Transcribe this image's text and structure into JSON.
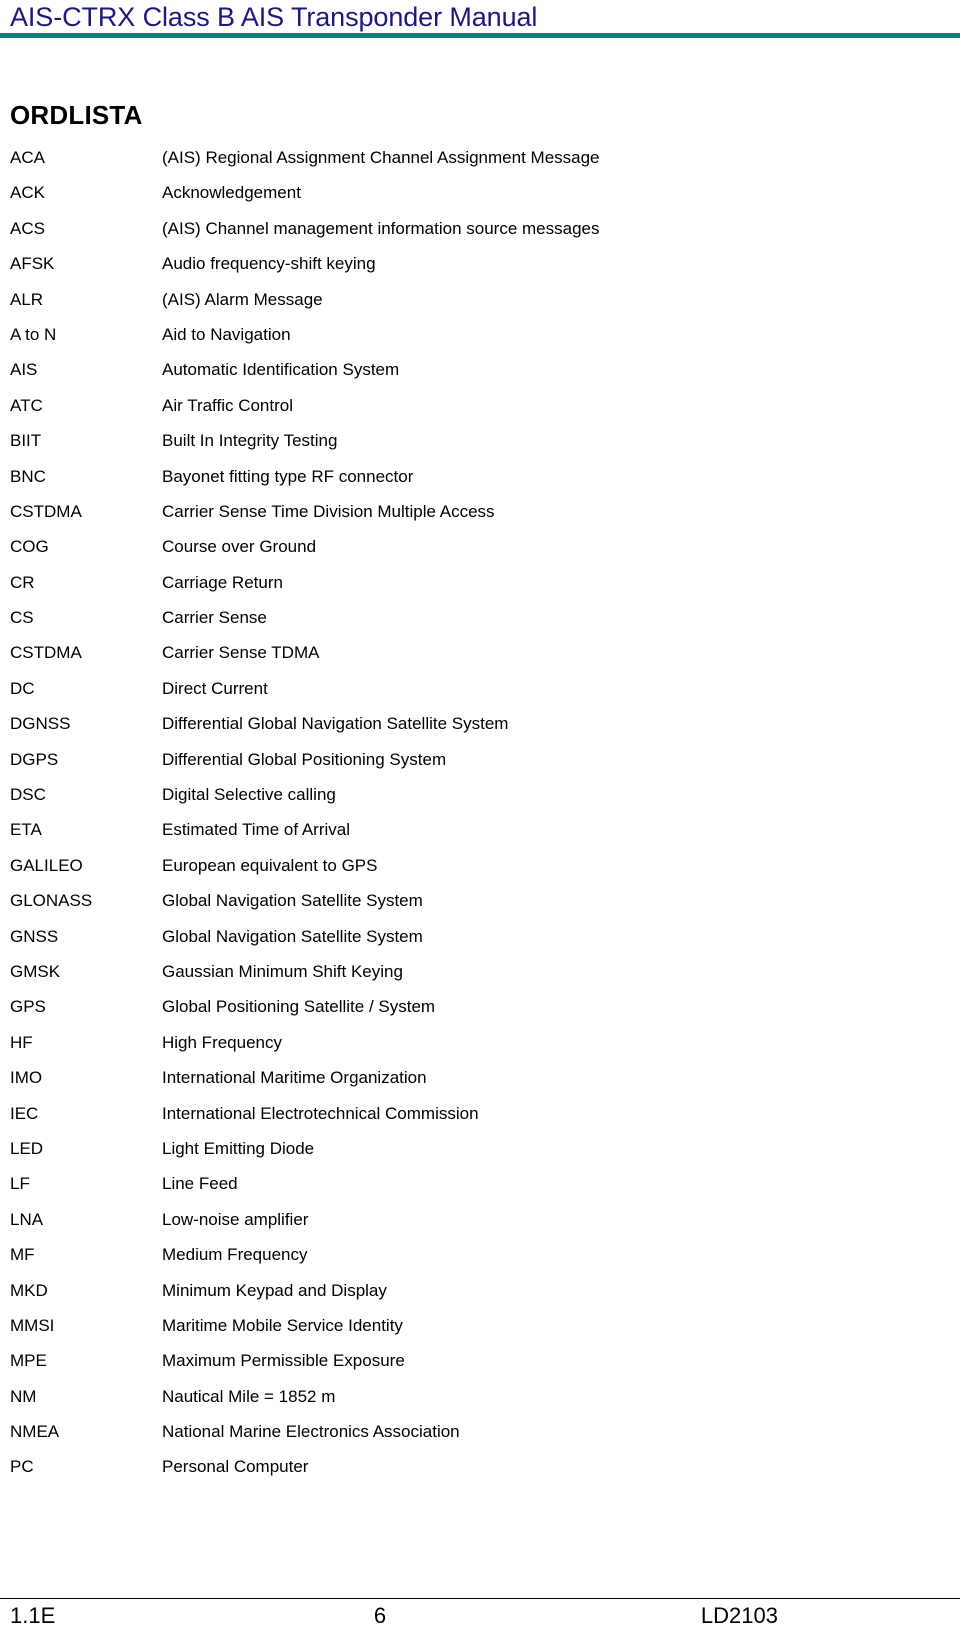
{
  "colors": {
    "header_title": "#1a1a7a",
    "header_rule": "#0e7d7d",
    "text": "#000000",
    "background": "#ffffff"
  },
  "header": {
    "title": "AIS-CTRX Class B AIS Transponder Manual"
  },
  "section": {
    "heading": "ORDLISTA"
  },
  "glossary": {
    "entries": [
      {
        "term": "ACA",
        "definition": "(AIS) Regional Assignment Channel Assignment Message"
      },
      {
        "term": "ACK",
        "definition": "Acknowledgement"
      },
      {
        "term": "ACS",
        "definition": "(AIS) Channel management information source messages"
      },
      {
        "term": "AFSK",
        "definition": "Audio frequency-shift keying"
      },
      {
        "term": "ALR",
        "definition": "(AIS) Alarm Message"
      },
      {
        "term": "A to N",
        "definition": "Aid to Navigation"
      },
      {
        "term": "AIS",
        "definition": "Automatic Identification System"
      },
      {
        "term": "ATC",
        "definition": "Air Traffic Control"
      },
      {
        "term": "BIIT",
        "definition": "Built In Integrity Testing"
      },
      {
        "term": "BNC",
        "definition": "Bayonet fitting type RF connector"
      },
      {
        "term": "CSTDMA",
        "definition": "Carrier Sense Time Division Multiple Access"
      },
      {
        "term": "COG",
        "definition": "Course over Ground"
      },
      {
        "term": "CR",
        "definition": "Carriage Return"
      },
      {
        "term": "CS",
        "definition": "Carrier Sense"
      },
      {
        "term": "CSTDMA",
        "definition": "Carrier Sense TDMA"
      },
      {
        "term": "DC",
        "definition": "Direct Current"
      },
      {
        "term": "DGNSS",
        "definition": "Differential Global Navigation Satellite System"
      },
      {
        "term": "DGPS",
        "definition": "Differential Global Positioning System"
      },
      {
        "term": "DSC",
        "definition": "Digital Selective calling"
      },
      {
        "term": "ETA",
        "definition": "Estimated Time of Arrival"
      },
      {
        "term": "GALILEO",
        "definition": "European equivalent to GPS"
      },
      {
        "term": "GLONASS",
        "definition": "Global Navigation Satellite System"
      },
      {
        "term": "GNSS",
        "definition": "Global Navigation Satellite System"
      },
      {
        "term": "GMSK",
        "definition": "Gaussian Minimum Shift Keying"
      },
      {
        "term": "GPS",
        "definition": "Global Positioning Satellite / System"
      },
      {
        "term": "HF",
        "definition": "High Frequency"
      },
      {
        "term": "IMO",
        "definition": "International Maritime Organization"
      },
      {
        "term": "IEC",
        "definition": "International Electrotechnical Commission"
      },
      {
        "term": "LED",
        "definition": "Light Emitting Diode"
      },
      {
        "term": "LF",
        "definition": "Line Feed"
      },
      {
        "term": "LNA",
        "definition": "Low-noise amplifier"
      },
      {
        "term": "MF",
        "definition": "Medium Frequency"
      },
      {
        "term": "MKD",
        "definition": "Minimum Keypad and Display"
      },
      {
        "term": "MMSI",
        "definition": "Maritime Mobile Service Identity"
      },
      {
        "term": "MPE",
        "definition": "Maximum Permissible Exposure"
      },
      {
        "term": "NM",
        "definition": "Nautical Mile = 1852 m"
      },
      {
        "term": "NMEA",
        "definition": "National Marine Electronics Association"
      },
      {
        "term": "PC",
        "definition": "Personal Computer"
      }
    ]
  },
  "footer": {
    "revision": "1.1E",
    "page_number": "6",
    "document_code": "LD2103"
  }
}
